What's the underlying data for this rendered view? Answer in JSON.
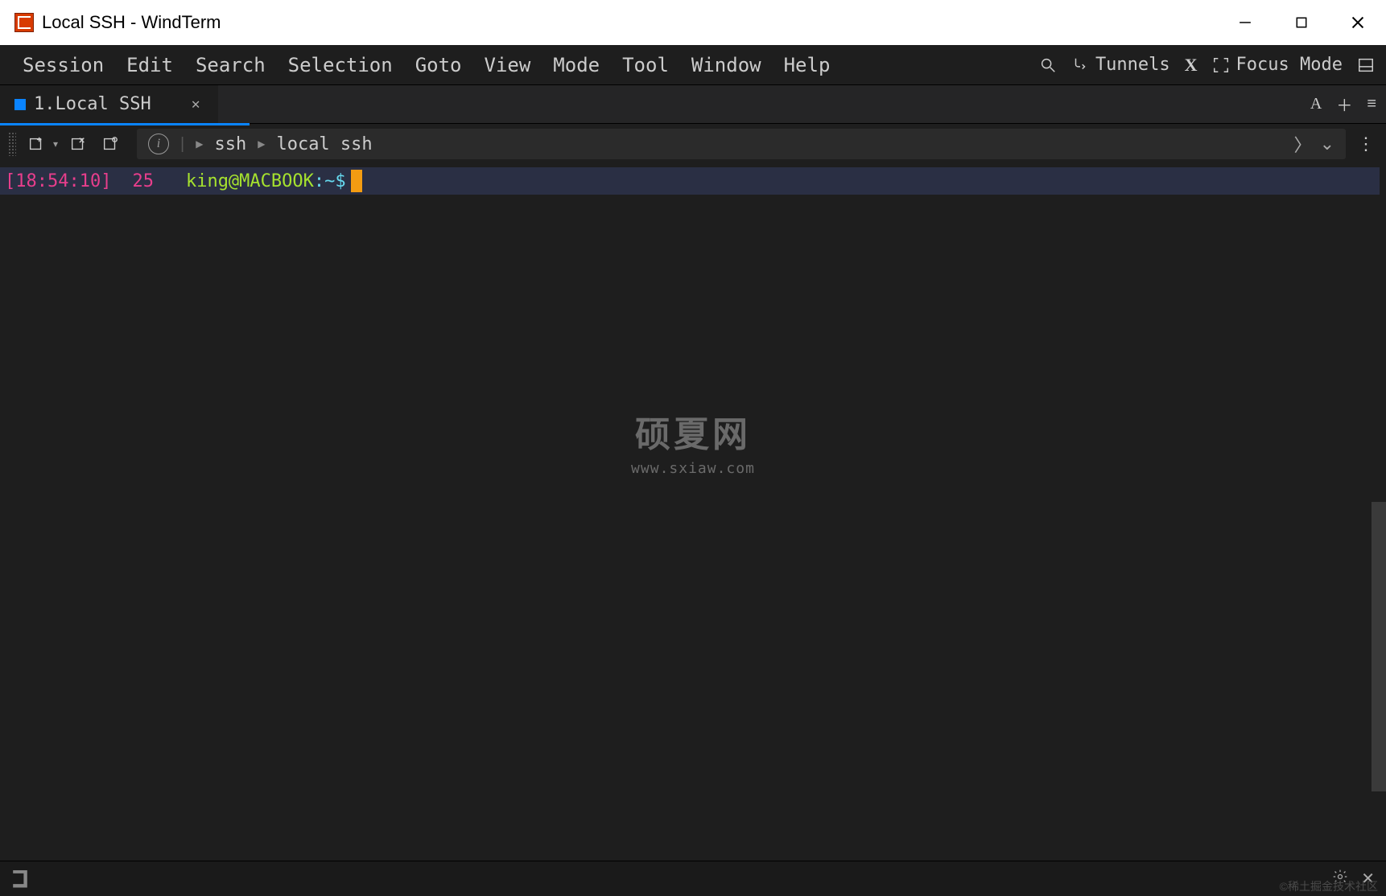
{
  "window": {
    "title": "Local SSH - WindTerm"
  },
  "menubar": {
    "items": [
      "Session",
      "Edit",
      "Search",
      "Selection",
      "Goto",
      "View",
      "Mode",
      "Tool",
      "Window",
      "Help"
    ],
    "right": {
      "tunnels": "Tunnels",
      "focus_mode": "Focus Mode"
    }
  },
  "tabs": {
    "items": [
      {
        "label": "1.Local SSH"
      }
    ],
    "font_button": "A"
  },
  "breadcrumb": {
    "seg1": "ssh",
    "seg2": "local ssh"
  },
  "terminal": {
    "timestamp": "[18:54:10]",
    "count": "25",
    "user_host": "king@MACBOOK",
    "path": "~",
    "prompt_symbol": "$"
  },
  "watermark": {
    "big": "硕夏网",
    "small": "www.sxiaw.com"
  },
  "footer": {
    "credit": "©稀土掘金技术社区"
  }
}
